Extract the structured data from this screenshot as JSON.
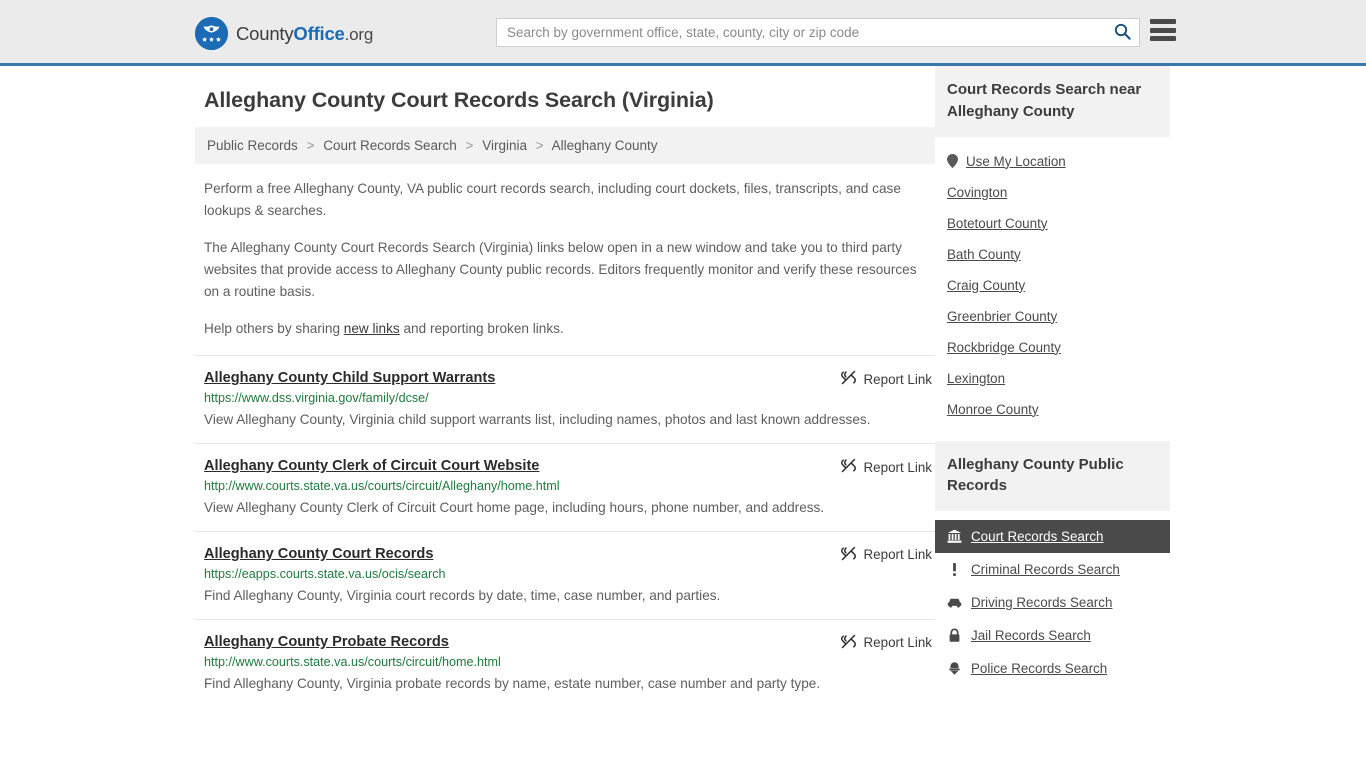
{
  "header": {
    "brand": {
      "part1": "County",
      "part2": "Office",
      "tld": ".org"
    },
    "search": {
      "placeholder": "Search by government office, state, county, city or zip code",
      "value": "",
      "search_icon": "search-icon"
    },
    "menu_icon": "hamburger-menu-icon",
    "accent_color": "#3b77ab",
    "background_color": "#ebebeb"
  },
  "main": {
    "title": "Alleghany County Court Records Search (Virginia)",
    "breadcrumb": [
      "Public Records",
      "Court Records Search",
      "Virginia",
      "Alleghany County"
    ],
    "breadcrumb_separator": ">",
    "intro": [
      "Perform a free Alleghany County, VA public court records search, including court dockets, files, transcripts, and case lookups & searches.",
      "The Alleghany County Court Records Search (Virginia) links below open in a new window and take you to third party websites that provide access to Alleghany County public records. Editors frequently monitor and verify these resources on a routine basis."
    ],
    "help_line": {
      "before": "Help others by sharing ",
      "link": "new links",
      "after": " and reporting broken links."
    },
    "report_link_label": "Report Link",
    "report_link_icon": "broken-link-icon",
    "url_color": "#1f7a3d",
    "results": [
      {
        "title": "Alleghany County Child Support Warrants",
        "url": "https://www.dss.virginia.gov/family/dcse/",
        "description": "View Alleghany County, Virginia child support warrants list, including names, photos and last known addresses."
      },
      {
        "title": "Alleghany County Clerk of Circuit Court Website",
        "url": "http://www.courts.state.va.us/courts/circuit/Alleghany/home.html",
        "description": "View Alleghany County Clerk of Circuit Court home page, including hours, phone number, and address."
      },
      {
        "title": "Alleghany County Court Records",
        "url": "https://eapps.courts.state.va.us/ocis/search",
        "description": "Find Alleghany County, Virginia court records by date, time, case number, and parties."
      },
      {
        "title": "Alleghany County Probate Records",
        "url": "http://www.courts.state.va.us/courts/circuit/home.html",
        "description": "Find Alleghany County, Virginia probate records by name, estate number, case number and party type."
      }
    ]
  },
  "sidebar": {
    "near_panel": {
      "title": "Court Records Search near Alleghany County",
      "use_my_location": {
        "label": "Use My Location",
        "icon": "map-pin-icon"
      },
      "items": [
        "Covington",
        "Botetourt County",
        "Bath County",
        "Craig County",
        "Greenbrier County",
        "Rockbridge County",
        "Lexington",
        "Monroe County"
      ]
    },
    "records_panel": {
      "title": "Alleghany County Public Records",
      "active_background": "#4a4a4a",
      "items": [
        {
          "label": "Court Records Search",
          "icon": "courthouse-icon",
          "active": true
        },
        {
          "label": "Criminal Records Search",
          "icon": "exclamation-icon",
          "active": false
        },
        {
          "label": "Driving Records Search",
          "icon": "car-icon",
          "active": false
        },
        {
          "label": "Jail Records Search",
          "icon": "lock-icon",
          "active": false
        },
        {
          "label": "Police Records Search",
          "icon": "police-badge-icon",
          "active": false
        }
      ]
    }
  }
}
